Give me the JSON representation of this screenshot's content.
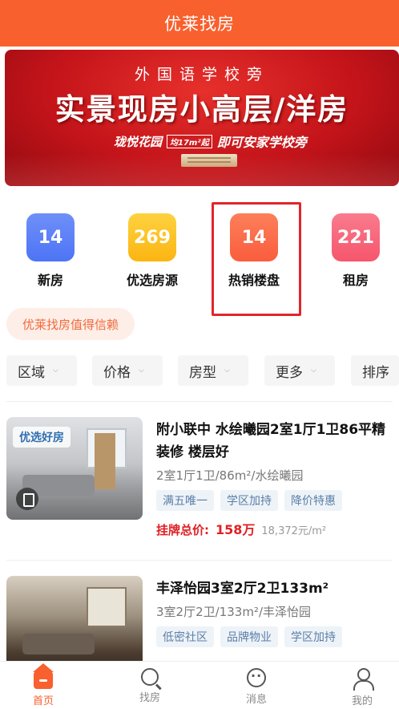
{
  "header": {
    "title": "优莱找房"
  },
  "banner": {
    "subtitle": "外国语学校旁",
    "headline": "实景现房小高层/洋房",
    "project": "珑悦花园",
    "price_tag": "均17m²起",
    "slogan": "即可安家学校旁"
  },
  "categories": [
    {
      "count": "14",
      "label": "新房",
      "color": "#4d74f5"
    },
    {
      "count": "269",
      "label": "优选房源",
      "color": "#fcb512"
    },
    {
      "count": "14",
      "label": "热销楼盘",
      "color": "#fa5d3d"
    },
    {
      "count": "221",
      "label": "租房",
      "color": "#f6566c"
    }
  ],
  "trust_banner": "优莱找房值得信赖",
  "filters": [
    {
      "label": "区域"
    },
    {
      "label": "价格"
    },
    {
      "label": "房型"
    },
    {
      "label": "更多"
    },
    {
      "label": "排序"
    }
  ],
  "listings": [
    {
      "thumb_tag": "优选好房",
      "title": "附小联中 水绘曦园2室1厅1卫86平精装修 楼层好",
      "meta": "2室1厅1卫/86m²/水绘曦园",
      "tags": [
        "满五唯一",
        "学区加持",
        "降价特惠"
      ],
      "price_label": "挂牌总价:",
      "price": "158万",
      "unit_price": "18,372元/m²"
    },
    {
      "thumb_tag": "",
      "title": "丰泽怡园3室2厅2卫133m²",
      "meta": "3室2厅2卫/133m²/丰泽怡园",
      "tags": [
        "低密社区",
        "品牌物业",
        "学区加持"
      ],
      "price_label": "",
      "price": "",
      "unit_price": ""
    }
  ],
  "tabbar": [
    {
      "label": "首页",
      "icon": "home-icon",
      "active": true
    },
    {
      "label": "找房",
      "icon": "search-icon",
      "active": false
    },
    {
      "label": "消息",
      "icon": "message-icon",
      "active": false
    },
    {
      "label": "我的",
      "icon": "user-icon",
      "active": false
    }
  ],
  "colors": {
    "brand": "#f8602e",
    "price": "#e02024",
    "highlight_box": "#e1262b"
  }
}
